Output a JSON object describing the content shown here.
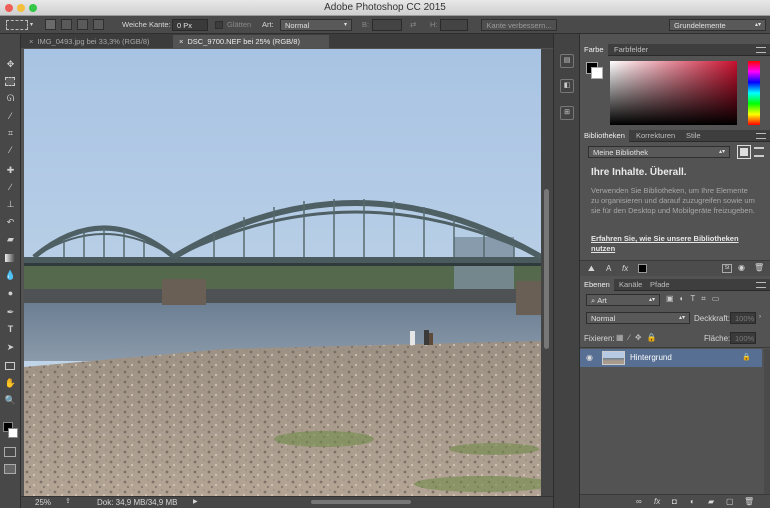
{
  "window": {
    "title": "Adobe Photoshop CC 2015"
  },
  "options": {
    "feather_label": "Weiche Kante:",
    "feather_value": "0 Px",
    "antialias_label": "Glätten",
    "style_label": "Art:",
    "style_value": "Normal",
    "width_label": "B:",
    "height_label": "H:",
    "refine_edge": "Kante verbessern...",
    "workspace": "Grundelemente"
  },
  "tabs": [
    {
      "label": "IMG_0493.jpg bei 33,3% (RGB/8)",
      "active": false
    },
    {
      "label": "DSC_9700.NEF bei 25% (RGB/8)",
      "active": true
    }
  ],
  "status": {
    "zoom": "25%",
    "doc": "Dok: 34,9 MB/34,9 MB"
  },
  "color_panel": {
    "tabs": [
      "Farbe",
      "Farbfelder"
    ]
  },
  "libraries": {
    "tabs": [
      "Bibliotheken",
      "Korrekturen",
      "Stile"
    ],
    "library_select": "Meine Bibliothek",
    "heading": "Ihre Inhalte. Überall.",
    "body": "Verwenden Sie Bibliotheken, um Ihre Elemente zu organisieren und darauf zuzugreifen sowie um sie für den Desktop und Mobilgeräte freizugeben.",
    "link": "Erfahren Sie, wie Sie unsere Bibliotheken nutzen"
  },
  "layers": {
    "tabs": [
      "Ebenen",
      "Kanäle",
      "Pfade"
    ],
    "filter": "Art",
    "blend": "Normal",
    "opacity_label": "Deckkraft:",
    "opacity_value": "100%",
    "lock_label": "Fixieren:",
    "fill_label": "Fläche:",
    "fill_value": "100%",
    "layer_name": "Hintergrund"
  },
  "colors": {
    "selection": "#566f93",
    "accent_blue": "#4a79c5"
  }
}
